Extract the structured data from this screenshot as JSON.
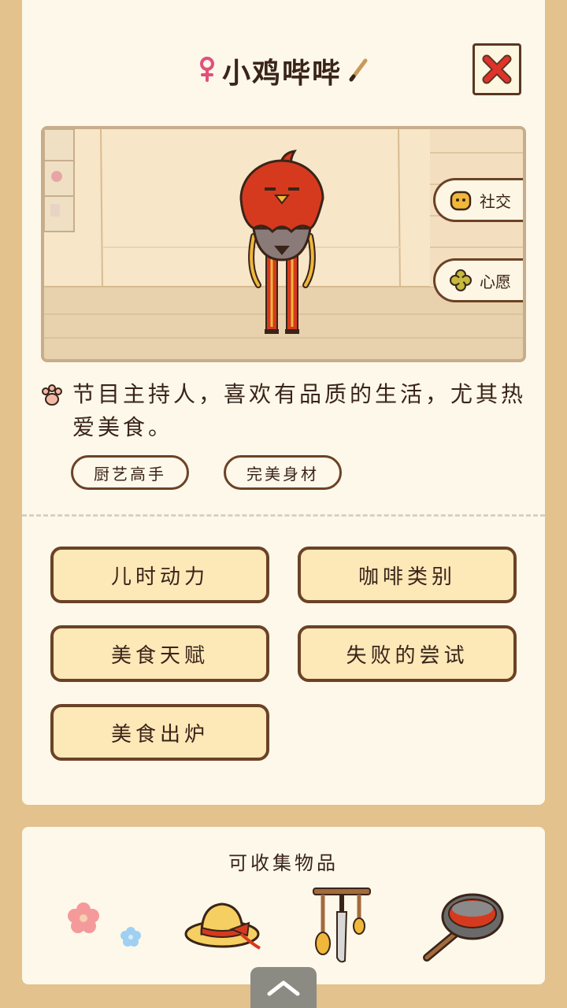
{
  "character": {
    "name": "小鸡哔哔",
    "gender_icon": "female-icon",
    "description": "节目主持人，喜欢有品质的生活，尤其热爱美食。",
    "tags": [
      "厨艺高手",
      "完美身材"
    ]
  },
  "scene": {
    "side_buttons": [
      {
        "label": "社交",
        "icon": "social-icon"
      },
      {
        "label": "心愿",
        "icon": "clover-icon"
      }
    ]
  },
  "stories": [
    "儿时动力",
    "咖啡类别",
    "美食天赋",
    "失败的尝试",
    "美食出炉"
  ],
  "collectibles": {
    "title": "可收集物品",
    "items": [
      "flowers-icon",
      "straw-hat-icon",
      "utensil-rack-icon",
      "frying-pan-icon"
    ]
  },
  "colors": {
    "background": "#e3c28e",
    "card": "#fdf8ea",
    "button_fill": "#fde8b8",
    "border": "#6b4226",
    "close_x": "#e0322a",
    "chicken_red": "#d63a1e"
  }
}
